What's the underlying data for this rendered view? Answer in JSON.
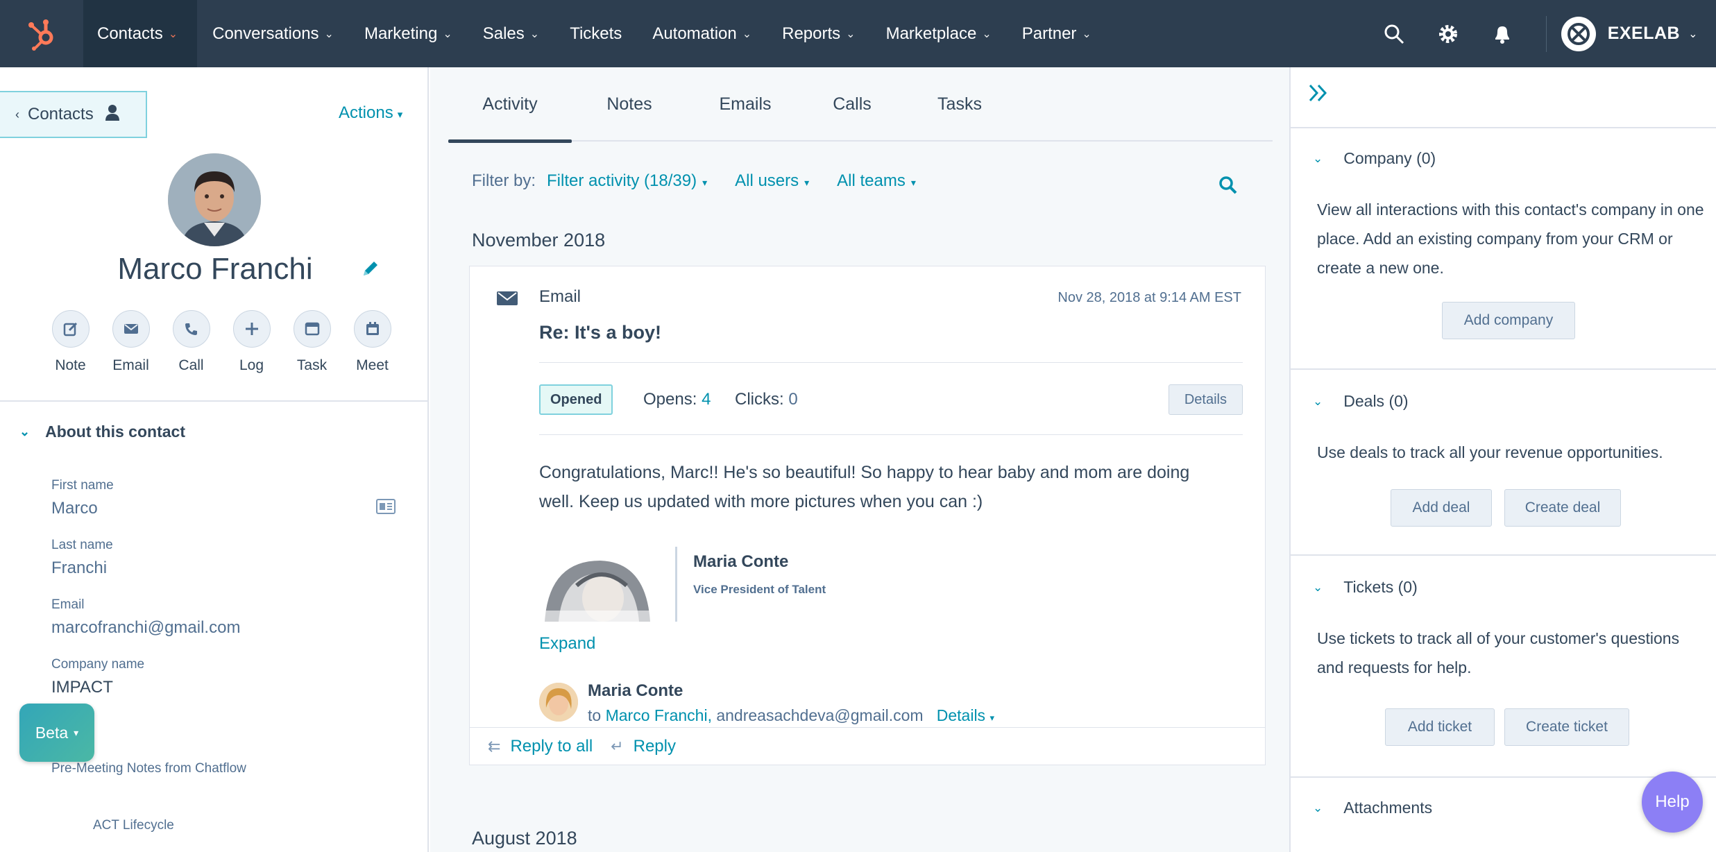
{
  "nav": {
    "items": [
      {
        "label": "Contacts",
        "active": true
      },
      {
        "label": "Conversations"
      },
      {
        "label": "Marketing"
      },
      {
        "label": "Sales"
      },
      {
        "label": "Tickets"
      },
      {
        "label": "Automation"
      },
      {
        "label": "Reports"
      },
      {
        "label": "Marketplace"
      },
      {
        "label": "Partner"
      }
    ],
    "account_name": "EXELAB",
    "icons": [
      "search-icon",
      "settings-gear-icon",
      "notification-bell-icon"
    ],
    "colors": {
      "bar": "#2d3e50",
      "accent": "#ff7a59"
    }
  },
  "contact": {
    "back_label": "Contacts",
    "actions_label": "Actions",
    "name": "Marco Franchi",
    "quick_actions": [
      {
        "label": "Note",
        "icon": "note-icon"
      },
      {
        "label": "Email",
        "icon": "email-icon"
      },
      {
        "label": "Call",
        "icon": "phone-icon"
      },
      {
        "label": "Log",
        "icon": "plus-icon"
      },
      {
        "label": "Task",
        "icon": "task-icon"
      },
      {
        "label": "Meet",
        "icon": "calendar-icon"
      }
    ],
    "about_title": "About this contact",
    "props": {
      "first_name_label": "First name",
      "first_name": "Marco",
      "last_name_label": "Last name",
      "last_name": "Franchi",
      "email_label": "Email",
      "email": "marcofranchi@gmail.com",
      "company_label": "Company name",
      "company": "IMPACT",
      "notes_label": "Pre-Meeting Notes from Chatflow",
      "lifecycle_label": "ACT Lifecycle"
    },
    "beta_label": "Beta"
  },
  "activity": {
    "tabs": [
      "Activity",
      "Notes",
      "Emails",
      "Calls",
      "Tasks"
    ],
    "filter_label": "Filter by:",
    "filter_activity": "Filter activity (18/39)",
    "filter_users": "All users",
    "filter_teams": "All teams",
    "month_1": "November 2018",
    "month_2": "August 2018",
    "card": {
      "type": "Email",
      "date": "Nov 28, 2018 at 9:14 AM EST",
      "subject": "Re: It's a boy!",
      "status_badge": "Opened",
      "opens_label": "Opens:",
      "opens": "4",
      "clicks_label": "Clicks:",
      "clicks": "0",
      "details_button": "Details",
      "body": "Congratulations, Marc!! He's so beautiful! So happy to hear baby and mom are doing well. Keep us updated with more pictures when you can :)",
      "signature_name": "Maria Conte",
      "signature_title": "Vice President of Talent",
      "expand_label": "Expand",
      "sender_name": "Maria Conte",
      "to_prefix": "to",
      "to_contact": "Marco Franchi,",
      "to_other": "andreasachdeva@gmail.com",
      "to_details": "Details",
      "reply_all_label": "Reply to all",
      "reply_label": "Reply"
    }
  },
  "sidebar": {
    "company": {
      "title": "Company (0)",
      "text": "View all interactions with this contact's company in one place. Add an existing company from your CRM or create a new one.",
      "button": "Add company"
    },
    "deals": {
      "title": "Deals (0)",
      "text": "Use deals to track all your revenue opportunities.",
      "add_button": "Add deal",
      "create_button": "Create deal"
    },
    "tickets": {
      "title": "Tickets (0)",
      "text": "Use tickets to track all of your customer's questions and requests for help.",
      "add_button": "Add ticket",
      "create_button": "Create ticket"
    },
    "attachments": {
      "title": "Attachments"
    },
    "help_label": "Help"
  }
}
